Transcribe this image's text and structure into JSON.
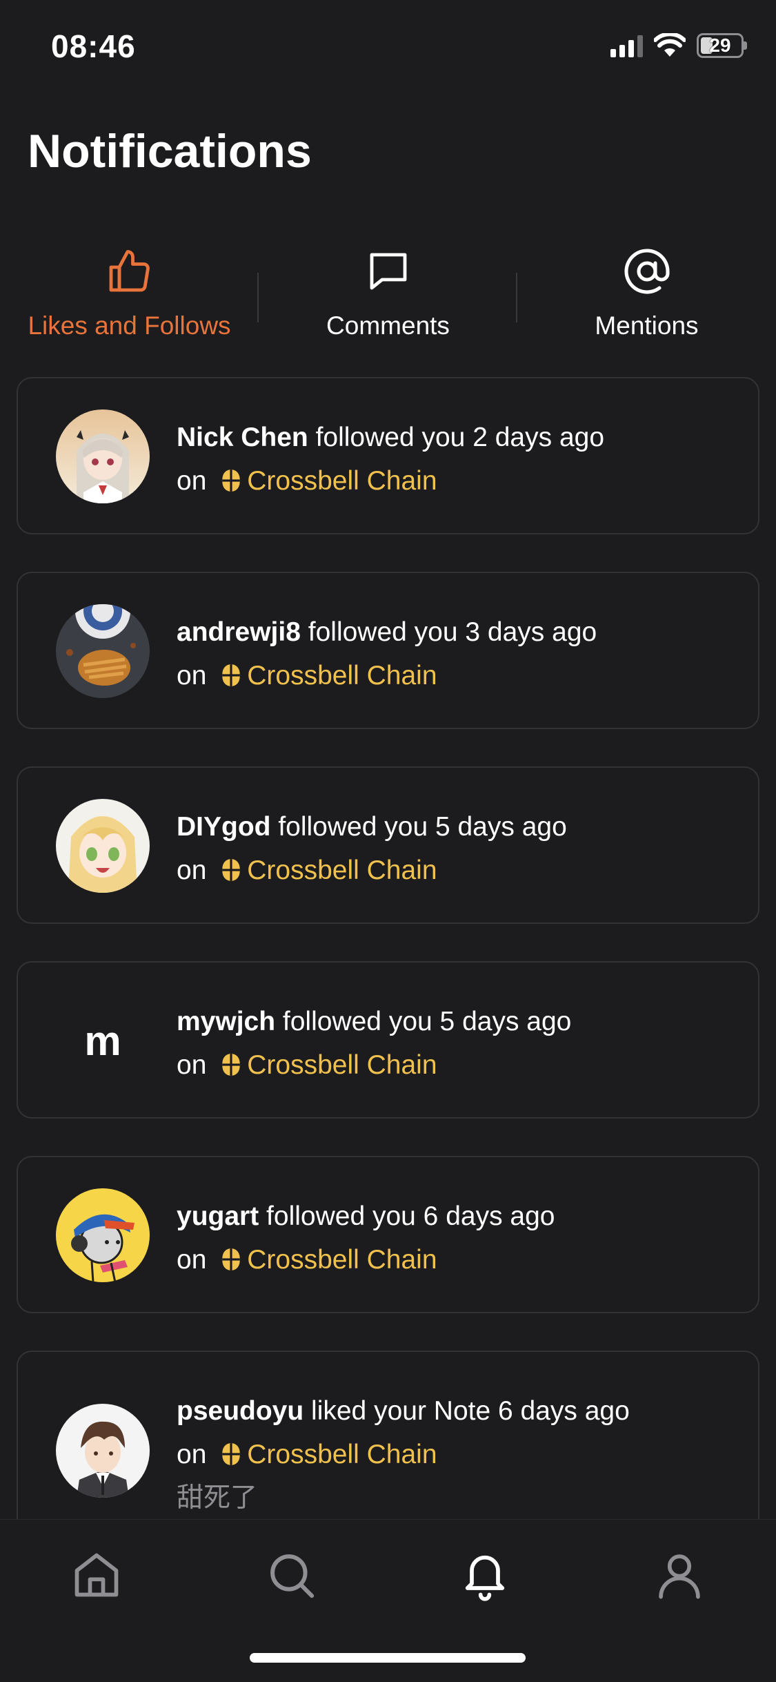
{
  "status_bar": {
    "time": "08:46",
    "battery": "29"
  },
  "header": {
    "title": "Notifications"
  },
  "tabs": [
    {
      "label": "Likes and Follows",
      "icon": "thumbs-up-icon",
      "active": true
    },
    {
      "label": "Comments",
      "icon": "comment-icon",
      "active": false
    },
    {
      "label": "Mentions",
      "icon": "at-sign-icon",
      "active": false
    }
  ],
  "notifications": [
    {
      "name": "Nick Chen",
      "action": "followed you 2 days ago",
      "on": "on",
      "chain": "Crossbell Chain",
      "avatar": "anime-girl-avatar"
    },
    {
      "name": "andrewji8",
      "action": "followed you 3 days ago",
      "on": "on",
      "chain": "Crossbell Chain",
      "avatar": "food-photo-avatar"
    },
    {
      "name": "DIYgod",
      "action": "followed you 5 days ago",
      "on": "on",
      "chain": "Crossbell Chain",
      "avatar": "anime-blonde-avatar"
    },
    {
      "name": "mywjch",
      "action": "followed you 5 days ago",
      "on": "on",
      "chain": "Crossbell Chain",
      "avatar_letter": "m"
    },
    {
      "name": "yugart",
      "action": "followed you 6 days ago",
      "on": "on",
      "chain": "Crossbell Chain",
      "avatar": "cartoon-gamer-avatar"
    },
    {
      "name": "pseudoyu",
      "action": "liked your Note 6 days ago",
      "on": "on",
      "chain": "Crossbell Chain",
      "avatar": "anime-boy-avatar",
      "note": "甜死了"
    }
  ],
  "bottom_nav": [
    {
      "icon": "home-icon"
    },
    {
      "icon": "search-icon"
    },
    {
      "icon": "bell-icon",
      "active": true
    },
    {
      "icon": "profile-icon"
    }
  ],
  "colors": {
    "accent": "#e8743b",
    "chain": "#f1c14d",
    "background": "#1c1c1e",
    "card_border": "#333336"
  }
}
